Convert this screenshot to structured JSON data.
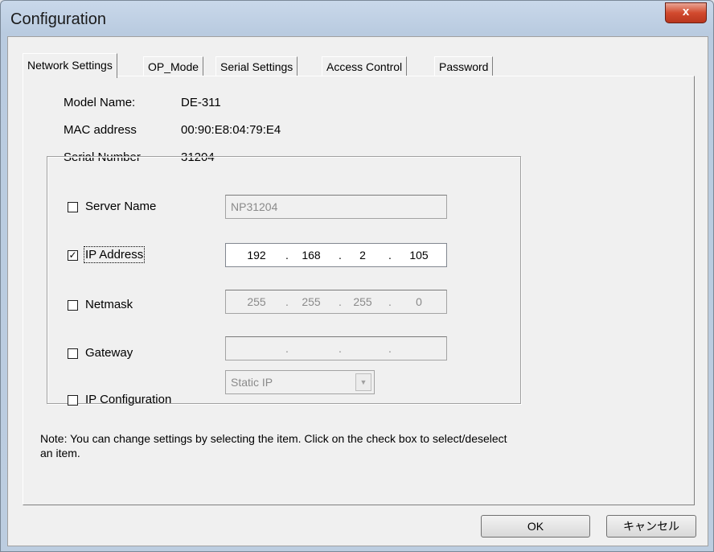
{
  "window": {
    "title": "Configuration",
    "close_glyph": "x"
  },
  "tabs": [
    {
      "label": "Network Settings"
    },
    {
      "label": "OP_Mode"
    },
    {
      "label": "Serial Settings"
    },
    {
      "label": "Access Control"
    },
    {
      "label": "Password"
    }
  ],
  "active_tab": "Network Settings",
  "device_info": {
    "model_label": "Model Name:",
    "model_value": "DE-311",
    "mac_label": "MAC address",
    "mac_value": "00:90:E8:04:79:E4",
    "serial_label": "Serial Number",
    "serial_value": "31204"
  },
  "settings": {
    "server_name": {
      "label": "Server Name",
      "checked": false,
      "value": "NP31204"
    },
    "ip_address": {
      "label": "IP Address",
      "checked": true,
      "octets": [
        "192",
        "168",
        "2",
        "105"
      ]
    },
    "netmask": {
      "label": "Netmask",
      "checked": false,
      "octets": [
        "255",
        "255",
        "255",
        "0"
      ]
    },
    "gateway": {
      "label": "Gateway",
      "checked": false,
      "octets": [
        "",
        "",
        "",
        ""
      ]
    },
    "ip_configuration": {
      "label": "IP Configuration",
      "checked": false,
      "selected": "Static IP"
    }
  },
  "note": "Note: You can change settings by selecting the item. Click on the check box to select/deselect an item.",
  "buttons": {
    "ok": "OK",
    "cancel": "キャンセル"
  },
  "check_glyph": "✓",
  "ip_separator": ".",
  "dropdown_glyph": "▼"
}
